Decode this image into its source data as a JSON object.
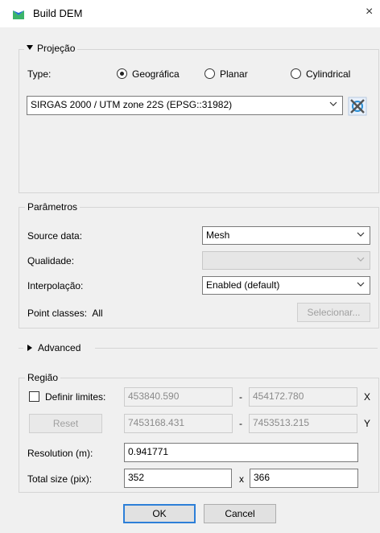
{
  "window": {
    "title": "Build DEM",
    "close_glyph": "×",
    "icon": "mesh-icon"
  },
  "projecao": {
    "title": "Projeção",
    "type_label": "Type:",
    "options": [
      "Geográfica",
      "Planar",
      "Cylindrical"
    ],
    "selected": "Geográfica",
    "crs_value": "SIRGAS 2000 / UTM zone 22S (EPSG::31982)",
    "crs_button_icon": "crs-selector-icon"
  },
  "parametros": {
    "title": "Parâmetros",
    "source_label": "Source data:",
    "source_value": "Mesh",
    "quality_label": "Qualidade:",
    "quality_value": "",
    "interp_label": "Interpolação:",
    "interp_value": "Enabled (default)",
    "point_classes_label": "Point classes:",
    "point_classes_value": "All",
    "select_button": "Selecionar..."
  },
  "advanced": {
    "title": "Advanced"
  },
  "regiao": {
    "title": "Região",
    "definir_label": "Definir limites:",
    "x_min": "453840.590",
    "x_max": "454172.780",
    "x_label": "X",
    "y_min": "7453168.431",
    "y_max": "7453513.215",
    "y_label": "Y",
    "dash": "-",
    "reset_button": "Reset",
    "resolution_label": "Resolution (m):",
    "resolution_value": "0.941771",
    "total_size_label": "Total size (pix):",
    "size_w": "352",
    "size_x": "x",
    "size_h": "366"
  },
  "footer": {
    "ok": "OK",
    "cancel": "Cancel"
  },
  "colors": {
    "accent": "#2d7fd8",
    "icon_green": "#3bb46a",
    "icon_blue": "#1e6fd0"
  }
}
